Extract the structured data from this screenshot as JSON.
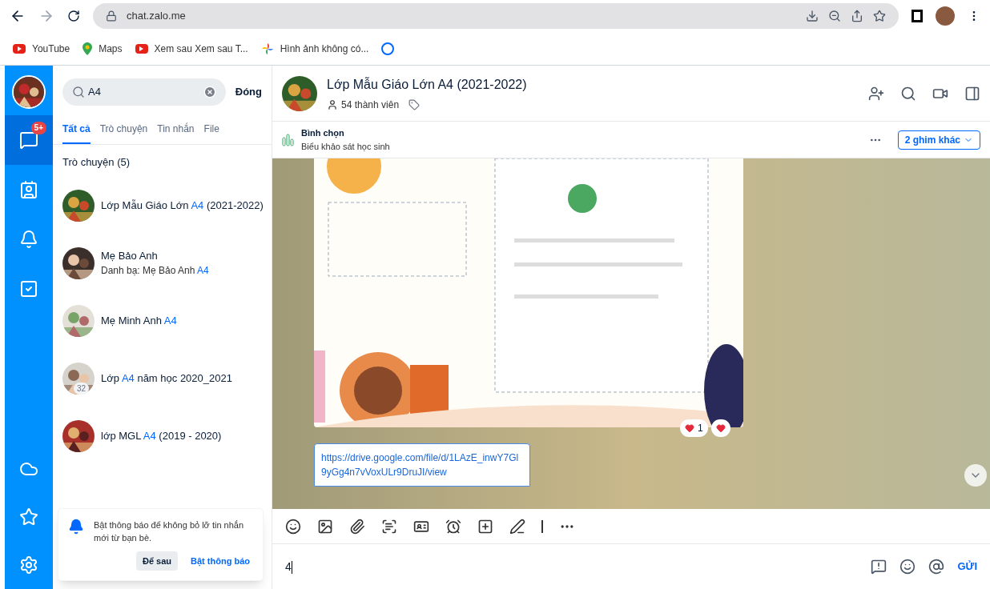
{
  "browser": {
    "url": "chat.zalo.me",
    "bookmarks": [
      {
        "label": "YouTube",
        "kind": "youtube"
      },
      {
        "label": "Maps",
        "kind": "maps"
      },
      {
        "label": "Xem sau Xem sau T...",
        "kind": "youtube"
      },
      {
        "label": "Hình ảnh không có...",
        "kind": "photos"
      }
    ]
  },
  "rail": {
    "items": [
      {
        "kind": "chat",
        "selected": true,
        "badge": "5+"
      },
      {
        "kind": "contacts",
        "selected": false
      },
      {
        "kind": "bell",
        "selected": false
      },
      {
        "kind": "todo",
        "selected": false
      }
    ],
    "bottom": [
      {
        "kind": "cloud"
      },
      {
        "kind": "star"
      },
      {
        "kind": "settings"
      }
    ]
  },
  "search": {
    "value": "A4",
    "close": "Đóng"
  },
  "filter_tabs": [
    {
      "label": "Tất cả",
      "selected": true
    },
    {
      "label": "Trò chuyện",
      "selected": false
    },
    {
      "label": "Tin nhắn",
      "selected": false
    },
    {
      "label": "File",
      "selected": false
    }
  ],
  "section_title": "Trò chuyện (5)",
  "results": [
    {
      "name": [
        {
          "text": "Lớp Mẫu Giáo Lớn ",
          "match": false
        },
        {
          "text": "A4",
          "match": true
        },
        {
          "text": " (2021-2022)",
          "match": false
        }
      ]
    },
    {
      "name": [
        {
          "text": "Mẹ Bảo Anh",
          "match": false
        }
      ],
      "subtitle": [
        {
          "text": "Danh bạ: Mẹ Bảo Anh ",
          "match": false
        },
        {
          "text": "A4",
          "match": true
        }
      ]
    },
    {
      "name": [
        {
          "text": "Mẹ Minh Anh ",
          "match": false
        },
        {
          "text": "A4",
          "match": true
        }
      ]
    },
    {
      "name": [
        {
          "text": "Lớp ",
          "match": false
        },
        {
          "text": "A4",
          "match": true
        },
        {
          "text": " năm học 2020_2021",
          "match": false
        }
      ],
      "member_count": "32"
    },
    {
      "name": [
        {
          "text": "lớp MGL ",
          "match": false
        },
        {
          "text": "A4",
          "match": true
        },
        {
          "text": " (2019 - 2020)",
          "match": false
        }
      ]
    }
  ],
  "notification": {
    "text": "Bật thông báo để không bỏ lỡ tin nhắn mới từ bạn bè.",
    "later": "Để sau",
    "enable": "Bật thông báo"
  },
  "chat": {
    "title": "Lớp Mẫu Giáo Lớn A4 (2021-2022)",
    "members": "54 thành viên",
    "pin": {
      "title": "Bình chọn",
      "subtitle": "Biểu khảo sát học sinh",
      "more": "2 ghim khác"
    },
    "reactions": [
      {
        "kind": "total",
        "count": "1"
      },
      {
        "kind": "mine"
      }
    ],
    "link": "https://drive.google.com/file/d/1LAzE_inwY7Gl9yGg4n7vVoxULr9DruJI/view",
    "composer_value": "4",
    "send": "GỬI"
  }
}
